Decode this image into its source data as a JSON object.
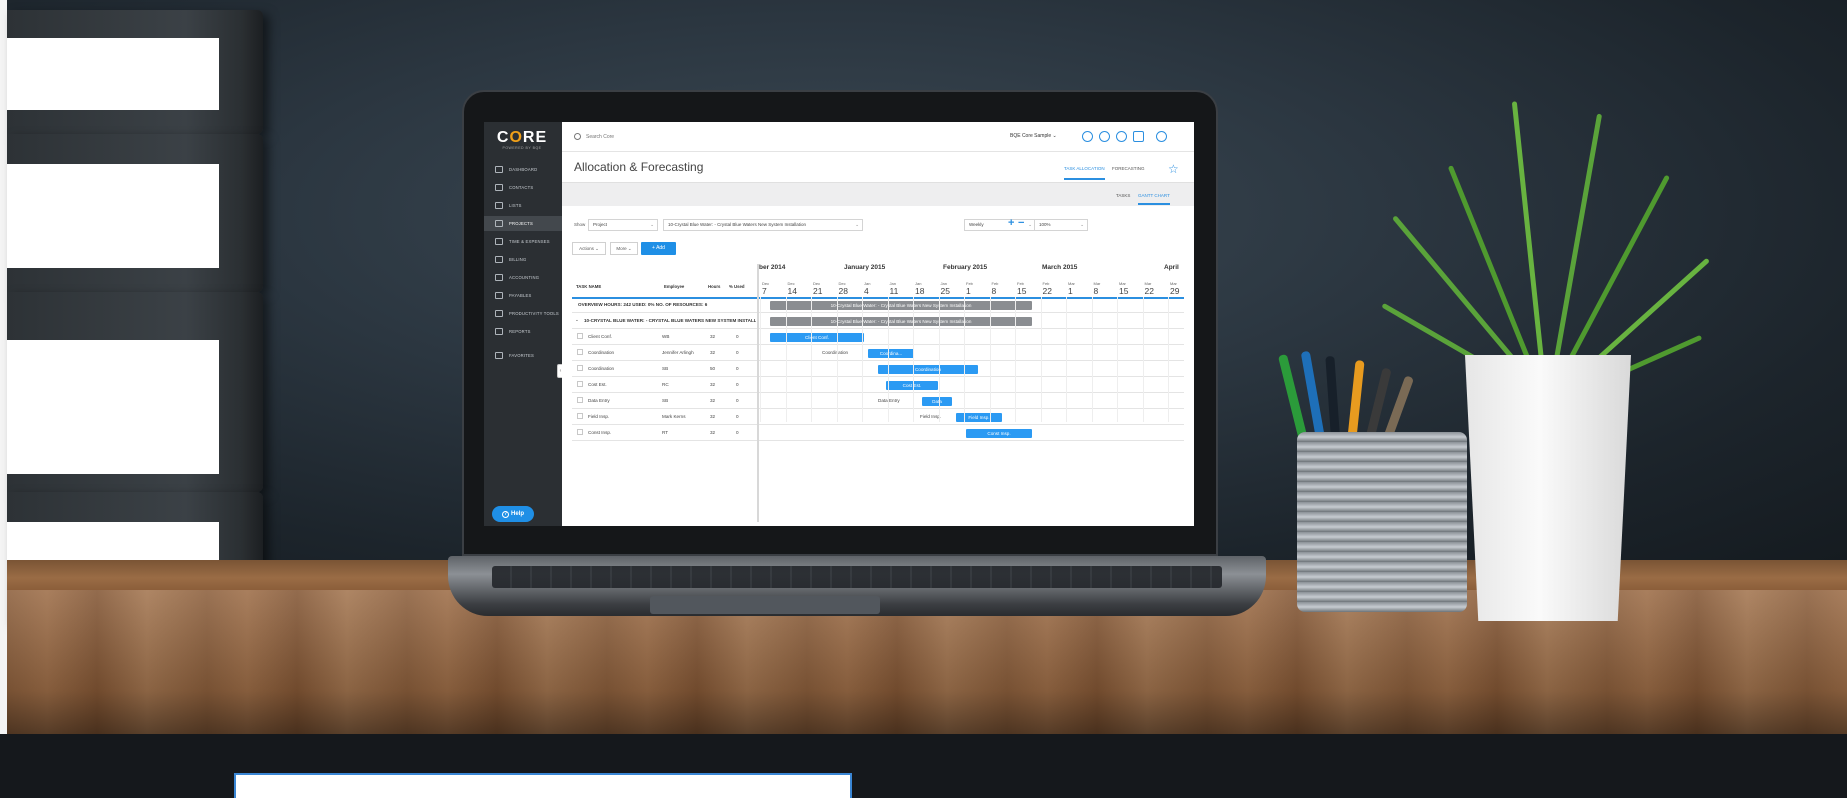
{
  "app": {
    "logo_text_pre": "C",
    "logo_text_o": "O",
    "logo_text_post": "RE",
    "logo_sub": "POWERED BY BQE",
    "accent_color": "#2b8fe0",
    "sidebar_bg": "#2b2f33"
  },
  "sidebar": {
    "items": [
      {
        "label": "DASHBOARD",
        "icon": "home-icon"
      },
      {
        "label": "CONTACTS",
        "icon": "contacts-icon"
      },
      {
        "label": "LISTS",
        "icon": "list-icon"
      },
      {
        "label": "PROJECTS",
        "icon": "projects-icon"
      },
      {
        "label": "TIME & EXPENSES",
        "icon": "clock-icon"
      },
      {
        "label": "BILLING",
        "icon": "billing-icon"
      },
      {
        "label": "ACCOUNTING",
        "icon": "accounting-icon"
      },
      {
        "label": "PAYABLES",
        "icon": "payables-icon"
      },
      {
        "label": "PRODUCTIVITY TOOLS",
        "icon": "tools-icon"
      },
      {
        "label": "REPORTS",
        "icon": "reports-icon"
      },
      {
        "label": "FAVORITES",
        "icon": "star-icon"
      }
    ],
    "help_label": "Help"
  },
  "topbar": {
    "search_placeholder": "Search Core",
    "company": "BQE Core Sample ⌄"
  },
  "header": {
    "title": "Allocation & Forecasting",
    "view_tabs": [
      "TASK ALLOCATION",
      "FORECASTING"
    ],
    "sub_tabs": [
      "TASKS",
      "GANTT CHART"
    ]
  },
  "filters": {
    "show_label": "Show",
    "type_value": "Project",
    "project_value": "10-Crystal Blue Water: - Crystal Blue Waters New System Installation",
    "period_value": "Weekly",
    "zoom_value": "100%",
    "actions_label": "Actions ⌄",
    "more_label": "More ⌄",
    "add_label": "+  Add"
  },
  "grid": {
    "columns": [
      "TASK NAME",
      "Employee",
      "Hours",
      "% Used"
    ],
    "overview": "OVERVIEW   HOURS: 242   USED: 0%   NO. OF RESOURCES: 6",
    "project_row": "10-CRYSTAL BLUE WATER: - CRYSTAL BLUE WATERS NEW SYSTEM INSTALLATION",
    "rows": [
      {
        "task": "Client Conf.",
        "employee": "WB",
        "hours": "32",
        "used": "0"
      },
      {
        "task": "Coordination",
        "employee": "Jennifer Arlingh",
        "hours": "32",
        "used": "0"
      },
      {
        "task": "Coordination",
        "employee": "SB",
        "hours": "50",
        "used": "0"
      },
      {
        "task": "Cost Est.",
        "employee": "RC",
        "hours": "32",
        "used": "0"
      },
      {
        "task": "Data Entry",
        "employee": "SB",
        "hours": "32",
        "used": "0"
      },
      {
        "task": "Field Insp.",
        "employee": "Mark Kerns",
        "hours": "32",
        "used": "0"
      },
      {
        "task": "Const Insp.",
        "employee": "RT",
        "hours": "32",
        "used": "0"
      }
    ]
  },
  "timeline": {
    "months": [
      "ber 2014",
      "January 2015",
      "February 2015",
      "March 2015",
      "April"
    ],
    "weeks": [
      {
        "mon": "Dec",
        "day": "7"
      },
      {
        "mon": "Dec",
        "day": "14"
      },
      {
        "mon": "Dec",
        "day": "21"
      },
      {
        "mon": "Dec",
        "day": "28"
      },
      {
        "mon": "Jan",
        "day": "4"
      },
      {
        "mon": "Jan",
        "day": "11"
      },
      {
        "mon": "Jan",
        "day": "18"
      },
      {
        "mon": "Jan",
        "day": "25"
      },
      {
        "mon": "Feb",
        "day": "1"
      },
      {
        "mon": "Feb",
        "day": "8"
      },
      {
        "mon": "Feb",
        "day": "15"
      },
      {
        "mon": "Feb",
        "day": "22"
      },
      {
        "mon": "Mar",
        "day": "1"
      },
      {
        "mon": "Mar",
        "day": "8"
      },
      {
        "mon": "Mar",
        "day": "15"
      },
      {
        "mon": "Mar",
        "day": "22"
      },
      {
        "mon": "Mar",
        "day": "29"
      }
    ],
    "bars": {
      "overview": "10-Crystal Blue Water: - Crystal Blue Waters New System Installation",
      "project": "10-Crystal Blue Water: - Crystal Blue Waters New System Installation",
      "client_conf": "Client Conf.",
      "coord1_label": "Coordination",
      "coord1_bar": "Coordina...",
      "coord2": "Coordination",
      "cost_est": "Cost Est.",
      "data_label": "Data Entry",
      "data_bar": "Data",
      "field_label": "Field Insp.",
      "field_bar": "Field Insp.",
      "const_insp": "Const Insp."
    }
  }
}
